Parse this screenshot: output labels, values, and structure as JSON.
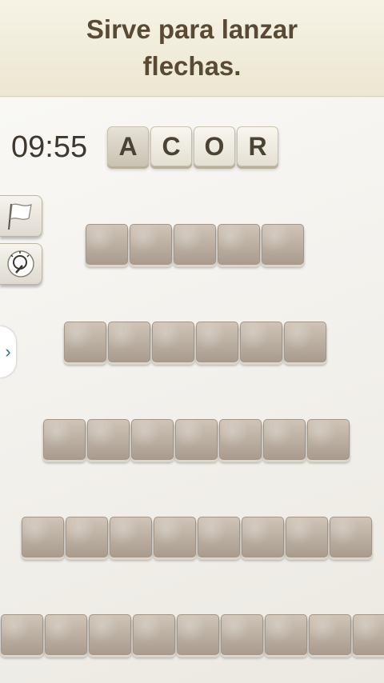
{
  "clue": {
    "text": "Sirve para lanzar flechas."
  },
  "timer": {
    "value": "09:55"
  },
  "letters": [
    {
      "char": "A",
      "used": true
    },
    {
      "char": "C",
      "used": false
    },
    {
      "char": "O",
      "used": false
    },
    {
      "char": "R",
      "used": false
    }
  ],
  "tools": {
    "flag": {
      "icon": "flag-icon"
    },
    "hint": {
      "icon": "lightbulb-icon"
    },
    "expand": {
      "icon": "chevron-right-icon",
      "glyph": "›"
    }
  },
  "rows": [
    {
      "length": 5
    },
    {
      "length": 6
    },
    {
      "length": 7
    },
    {
      "length": 8
    },
    {
      "length": 9
    }
  ]
}
